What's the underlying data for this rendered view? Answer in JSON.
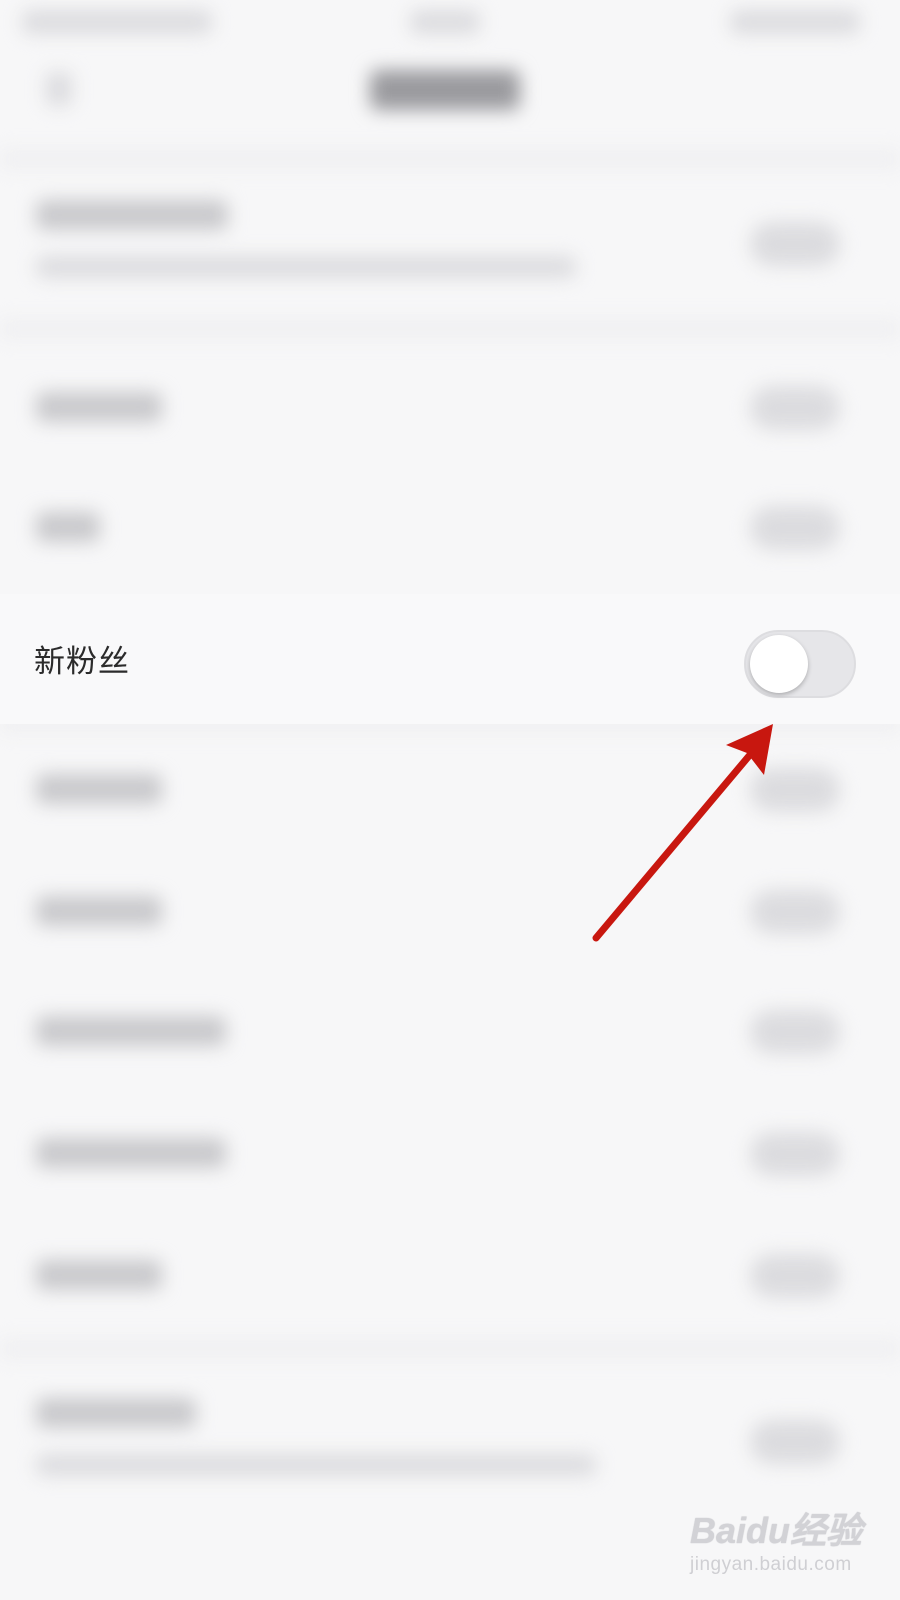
{
  "settings": {
    "new_fans_label": "新粉丝",
    "new_fans_toggle": "off"
  },
  "annotation": {
    "arrow_color": "#c8170f"
  },
  "watermark": {
    "logo": "Baidu经验",
    "url": "jingyan.baidu.com"
  },
  "colors": {
    "toggle_off": "#e6e6e9",
    "background": "#f7f7f8"
  }
}
